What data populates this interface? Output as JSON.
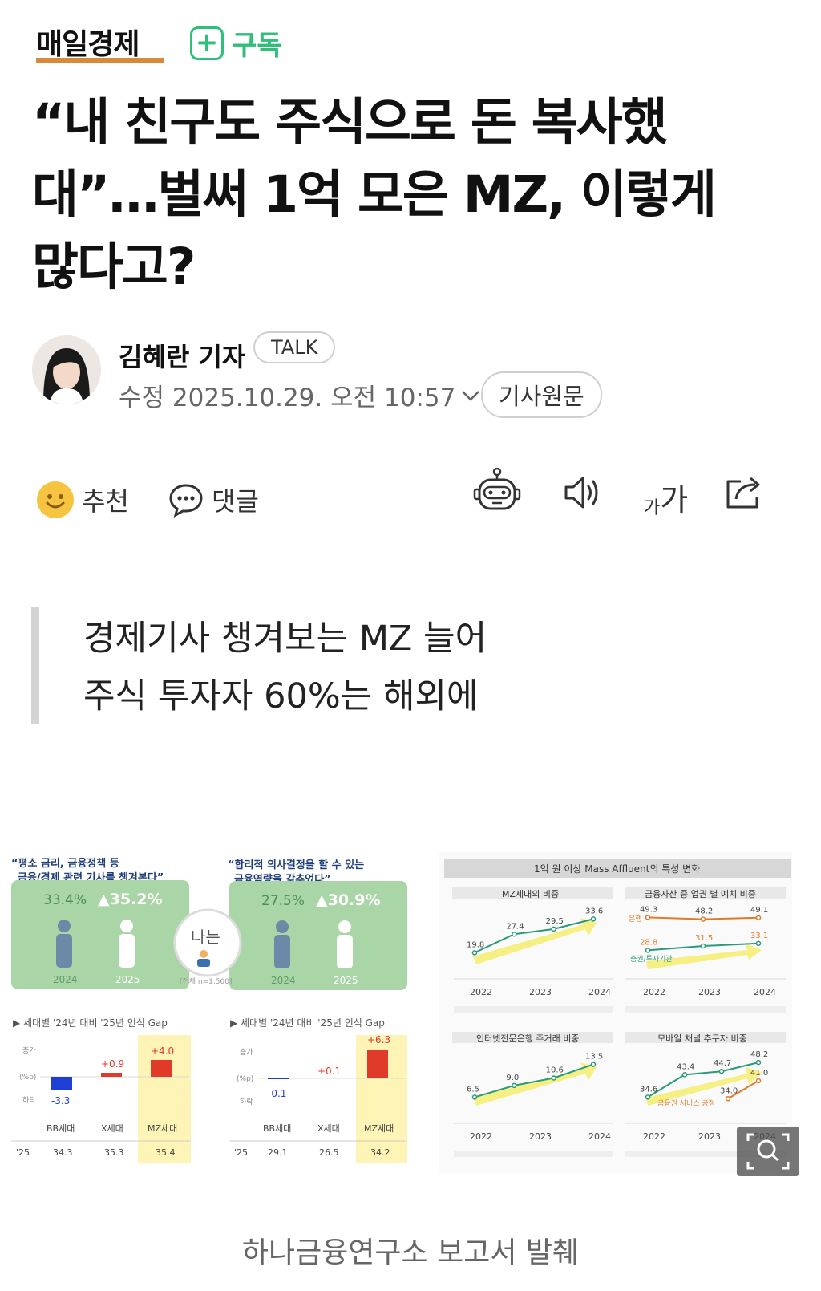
{
  "brand": {
    "name": "매일경제",
    "subscribe_label": "구독"
  },
  "article": {
    "title_lines": [
      "“내 친구도 주식으로 돈 복사했",
      "대”…벌써 1억 모은 MZ, 이렇게",
      "많다고?"
    ]
  },
  "byline": {
    "author": "김혜란 기자",
    "talk_label": "TALK",
    "date": "수정 2025.10.29. 오전 10:57",
    "original_label": "기사원문"
  },
  "toolbar": {
    "recommend_label": "추천",
    "comment_label": "댓글",
    "font_label_small": "가",
    "font_label_large": "가"
  },
  "summary": {
    "lines": [
      "경제기사 챙겨보는 MZ 늘어",
      "주식 투자자 60%는 해외에"
    ]
  },
  "infographic": {
    "left_panel": {
      "q1_title": [
        "“평소 금리, 금융정책 등",
        "금융/경제 관련 기사를 챙겨본다”"
      ],
      "q2_title": [
        "“합리적 의사결정을 할 수 있는",
        "금융역량을 갖추었다”"
      ],
      "center_label": "나는",
      "center_note": "[전체 n=1,500]",
      "q1": {
        "v2024": "33.4%",
        "v2025": "▲35.2%",
        "y2024": "2024",
        "y2025": "2025"
      },
      "q2": {
        "v2024": "27.5%",
        "v2025": "▲30.9%",
        "y2024": "2024",
        "y2025": "2025"
      },
      "gap_title": "▶ 세대별 '24년 대비 '25년 인식 Gap",
      "axis_up": "증가",
      "axis_unit": "(%p)",
      "axis_down": "하락",
      "row_label": "'25",
      "gap1": {
        "categories": [
          "BB세대",
          "X세대",
          "MZ세대"
        ],
        "gaps": [
          "-3.3",
          "+0.9",
          "+4.0"
        ],
        "values": [
          "34.3",
          "35.3",
          "35.4"
        ]
      },
      "gap2": {
        "categories": [
          "BB세대",
          "X세대",
          "MZ세대"
        ],
        "gaps": [
          "-0.1",
          "+0.1",
          "+6.3"
        ],
        "values": [
          "29.1",
          "26.5",
          "34.2"
        ]
      }
    },
    "right_panel": {
      "title": "1억 원 이상 Mass Affluent의 특성 변화",
      "c1": {
        "title": "MZ세대의 비중"
      },
      "c2": {
        "title": "금융자산 중 업권 별 예치 비중",
        "label_bank": "은행",
        "label_sec": "증권/투자기관"
      },
      "c3": {
        "title": "인터넷전문은행 주거래 비중"
      },
      "c4": {
        "title": "모바일 채널 추구자 비중",
        "label_sub": "금융권 서비스 긍정"
      }
    }
  },
  "chart_data": [
    {
      "type": "line",
      "title": "MZ세대의 비중",
      "x": [
        "2022",
        "2023",
        "2024"
      ],
      "series": [
        {
          "values": [
            19.8,
            27.4,
            29.5,
            33.6
          ]
        }
      ]
    },
    {
      "type": "line",
      "title": "금융자산 중 업권 별 예치 비중",
      "x": [
        "2022",
        "2023",
        "2024"
      ],
      "series": [
        {
          "name": "은행",
          "values": [
            49.3,
            48.2,
            49.1
          ]
        },
        {
          "name": "증권/투자기관",
          "values": [
            28.8,
            31.5,
            33.1
          ]
        }
      ]
    },
    {
      "type": "line",
      "title": "인터넷전문은행 주거래 비중",
      "x": [
        "2022",
        "2023",
        "2024"
      ],
      "series": [
        {
          "values": [
            6.5,
            9.0,
            10.6,
            13.5
          ]
        }
      ]
    },
    {
      "type": "line",
      "title": "모바일 채널 추구자 비중",
      "x": [
        "2022",
        "2023",
        "2024"
      ],
      "series": [
        {
          "values": [
            34.6,
            43.4,
            44.7,
            48.2
          ]
        },
        {
          "name": "금융권 서비스 긍정",
          "values": [
            34.0,
            41.0
          ]
        }
      ]
    }
  ],
  "caption": "하나금융연구소 보고서 발췌"
}
